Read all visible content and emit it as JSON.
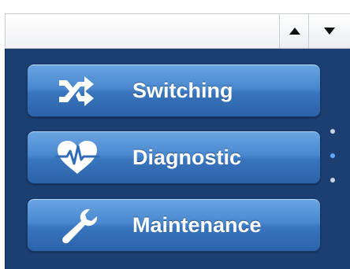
{
  "scroll_controls": {
    "up_icon": "triangle-up-icon",
    "down_icon": "triangle-down-icon"
  },
  "menu": {
    "items": [
      {
        "label": "Switching",
        "icon": "shuffle-arrows-icon"
      },
      {
        "label": "Diagnostic",
        "icon": "heartbeat-icon"
      },
      {
        "label": "Maintenance",
        "icon": "wrench-icon"
      }
    ]
  },
  "pagination": {
    "count": 3,
    "active_index": 1
  },
  "colors": {
    "panel_background": "#1c3f72",
    "button_top": "#6aa6e3",
    "button_bottom": "#2c63a8",
    "active_dot": "#5fa7ff"
  }
}
